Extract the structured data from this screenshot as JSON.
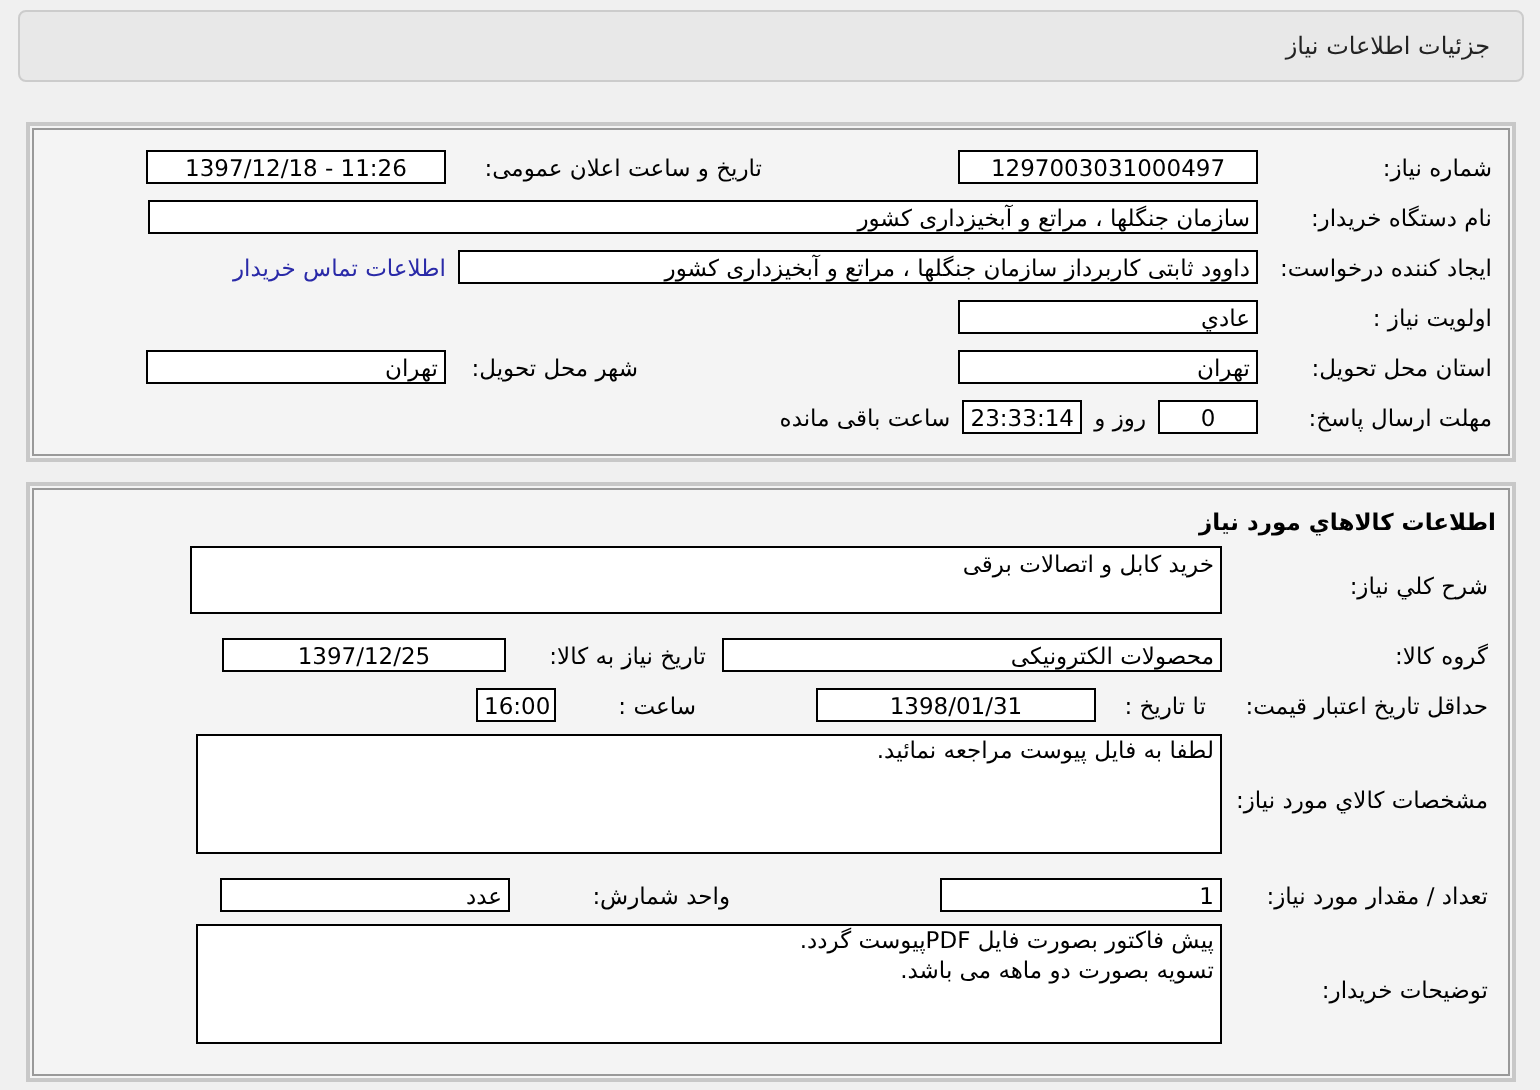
{
  "page_title": "جزئیات اطلاعات نیاز",
  "need_details": {
    "need_number": {
      "label": "شماره نیاز:",
      "value": "1297003031000497"
    },
    "announcement_datetime": {
      "label": "تاریخ و ساعت اعلان عمومی:",
      "value": "1397/12/18 - 11:26"
    },
    "buyer_organization": {
      "label": "نام دستگاه خریدار:",
      "value": "سازمان جنگلها ، مراتع و آبخیزداری کشور"
    },
    "requester": {
      "label": "ایجاد کننده درخواست:",
      "value": "داوود  ثابتی کاربرداز سازمان جنگلها ، مراتع و آبخیزداری کشور"
    },
    "buyer_contact_link": "اطلاعات تماس خریدار",
    "priority": {
      "label": "اولویت نیاز :",
      "value": "عادي"
    },
    "delivery_province": {
      "label": "استان محل تحویل:",
      "value": "تهران"
    },
    "delivery_city": {
      "label": "شهر محل تحویل:",
      "value": "تهران"
    },
    "response_deadline": {
      "label": "مهلت ارسال پاسخ:",
      "days": "0",
      "days_unit": "روز و",
      "time": "23:33:14",
      "time_suffix": "ساعت باقی مانده"
    }
  },
  "goods_info": {
    "heading": "اطلاعات کالاهاي مورد نیاز",
    "general_description": {
      "label": "شرح کلي نیاز:",
      "value": "خرید کابل و اتصالات برقی"
    },
    "goods_group": {
      "label": "گروه کالا:",
      "value": "محصولات الکترونیکی"
    },
    "need_date": {
      "label": "تاریخ نیاز به کالا:",
      "value": "1397/12/25"
    },
    "price_validity": {
      "label": "حداقل تاریخ اعتبار قیمت:",
      "date_label": "تا تاریخ :",
      "date": "1398/01/31",
      "time_label": "ساعت :",
      "time": "16:00"
    },
    "specifications": {
      "label": "مشخصات کالاي مورد نیاز:",
      "value": "لطفا به فایل پیوست مراجعه نمائید."
    },
    "quantity": {
      "label": "تعداد / مقدار مورد نیاز:",
      "value": "1"
    },
    "unit": {
      "label": "واحد شمارش:",
      "value": "عدد"
    },
    "buyer_notes": {
      "label": "توضیحات خریدار:",
      "lines": [
        "پیش فاکتور بصورت فایل PDFپیوست گردد.",
        "تسویه بصورت دو ماهه می باشد."
      ]
    }
  }
}
